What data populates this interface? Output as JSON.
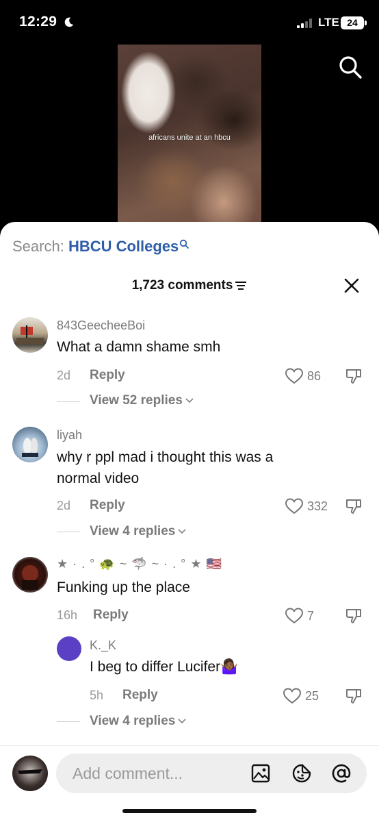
{
  "status_bar": {
    "time": "12:29",
    "network": "LTE",
    "battery": "24"
  },
  "video": {
    "caption": "africans unite at an hbcu"
  },
  "search": {
    "label": "Search: ",
    "term": "HBCU Colleges"
  },
  "comments_header": {
    "count": "1,723 comments"
  },
  "comments": [
    {
      "username": "843GeecheeBoi",
      "text": "What a damn shame smh",
      "age": "2d",
      "reply_label": "Reply",
      "likes": "86",
      "view_replies": "View 52 replies"
    },
    {
      "username": "liyah",
      "text_line1": "why r ppl mad i thought this was a",
      "text_line2": "normal video",
      "age": "2d",
      "reply_label": "Reply",
      "likes": "332",
      "view_replies": "View 4 replies"
    },
    {
      "username": "★ · . ° 🐢 ~ 🦈 ~ · . ° ★ 🇺🇸",
      "text": "Funking up the place",
      "age": "16h",
      "reply_label": "Reply",
      "likes": "7",
      "reply": {
        "username": "K._K",
        "text": "I beg to differ Lucifer🤷🏾‍♀️",
        "age": "5h",
        "reply_label": "Reply",
        "likes": "25"
      },
      "view_replies": "View 4 replies"
    }
  ],
  "composer": {
    "placeholder": "Add comment..."
  },
  "icons": [
    "moon-icon",
    "signal-icon",
    "search-icon",
    "filter-icon",
    "close-icon",
    "heart-icon",
    "dislike-icon",
    "chevron-down-icon",
    "image-icon",
    "sticker-icon",
    "at-icon"
  ],
  "colors": {
    "accent_link": "#2f5ea8",
    "reply_avatar": "#5b3fc4"
  }
}
